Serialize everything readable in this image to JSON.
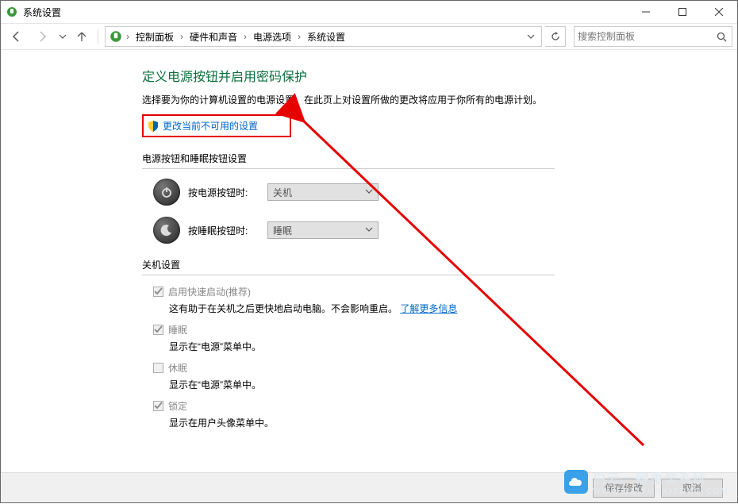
{
  "window": {
    "title": "系统设置"
  },
  "breadcrumb": {
    "items": [
      "控制面板",
      "硬件和声音",
      "电源选项",
      "系统设置"
    ]
  },
  "search": {
    "placeholder": "搜索控制面板"
  },
  "page": {
    "heading": "定义电源按钮并启用密码保护",
    "desc": "选择要为你的计算机设置的电源设置。在此页上对设置所做的更改将应用于你所有的电源计划。",
    "change_link": "更改当前不可用的设置"
  },
  "sections": {
    "buttons_label": "电源按钮和睡眠按钮设置",
    "power_button": {
      "label": "按电源按钮时:",
      "value": "关机"
    },
    "sleep_button": {
      "label": "按睡眠按钮时:",
      "value": "睡眠"
    },
    "shutdown_label": "关机设置",
    "fast_startup": {
      "label": "启用快速启动(推荐)",
      "desc_prefix": "这有助于在关机之后更快地启动电脑。不会影响重启。",
      "desc_link": "了解更多信息"
    },
    "sleep_opt": {
      "label": "睡眠",
      "desc": "显示在“电源”菜单中。"
    },
    "hibernate_opt": {
      "label": "休眠",
      "desc": "显示在“电源”菜单中。"
    },
    "lock_opt": {
      "label": "锁定",
      "desc": "显示在用户头像菜单中。"
    }
  },
  "footer": {
    "save": "保存修改",
    "cancel": "取消"
  },
  "watermark": {
    "text": "白云一键重装系统",
    "url": "WWW.BAIYUNXITONG.COM"
  }
}
